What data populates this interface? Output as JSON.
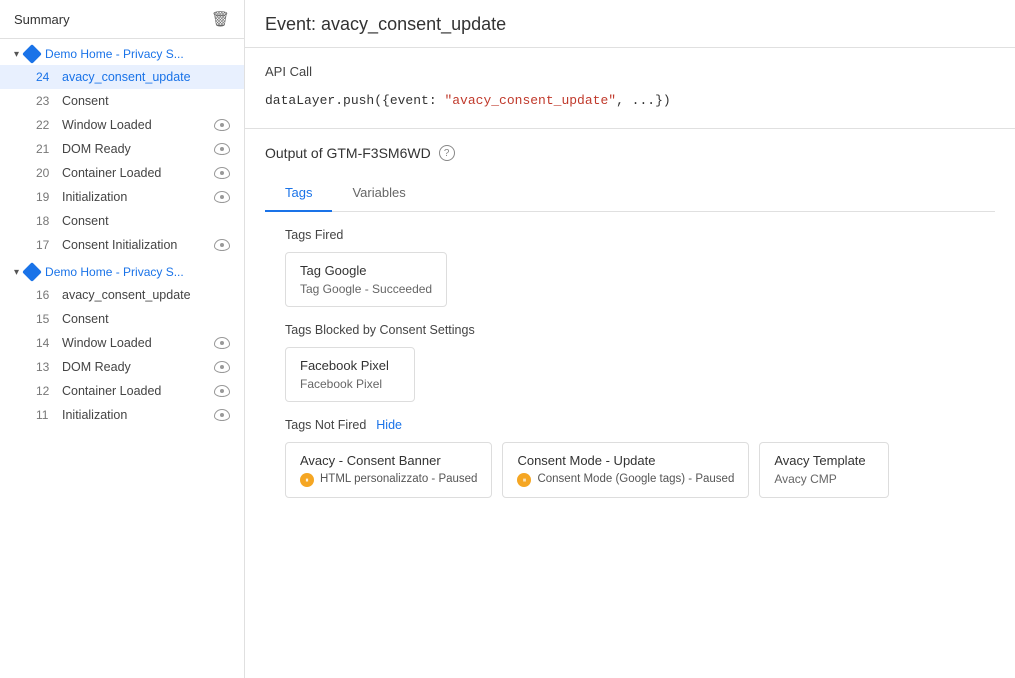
{
  "sidebar": {
    "header": {
      "title": "Summary",
      "trash_icon": "🗑"
    },
    "groups": [
      {
        "label": "Demo Home - Privacy S...",
        "id": "group1",
        "items": [
          {
            "num": "24",
            "label": "avacy_consent_update",
            "active": true,
            "has_eye": false
          },
          {
            "num": "23",
            "label": "Consent",
            "active": false,
            "has_eye": false
          },
          {
            "num": "22",
            "label": "Window Loaded",
            "active": false,
            "has_eye": true
          },
          {
            "num": "21",
            "label": "DOM Ready",
            "active": false,
            "has_eye": true
          },
          {
            "num": "20",
            "label": "Container Loaded",
            "active": false,
            "has_eye": true
          },
          {
            "num": "19",
            "label": "Initialization",
            "active": false,
            "has_eye": true
          },
          {
            "num": "18",
            "label": "Consent",
            "active": false,
            "has_eye": false
          },
          {
            "num": "17",
            "label": "Consent Initialization",
            "active": false,
            "has_eye": true
          }
        ]
      },
      {
        "label": "Demo Home - Privacy S...",
        "id": "group2",
        "items": [
          {
            "num": "16",
            "label": "avacy_consent_update",
            "active": false,
            "has_eye": false
          },
          {
            "num": "15",
            "label": "Consent",
            "active": false,
            "has_eye": false
          },
          {
            "num": "14",
            "label": "Window Loaded",
            "active": false,
            "has_eye": true
          },
          {
            "num": "13",
            "label": "DOM Ready",
            "active": false,
            "has_eye": true
          },
          {
            "num": "12",
            "label": "Container Loaded",
            "active": false,
            "has_eye": true
          },
          {
            "num": "11",
            "label": "Initialization",
            "active": false,
            "has_eye": true
          }
        ]
      }
    ]
  },
  "main": {
    "event_title": "Event: avacy_consent_update",
    "api_call_title": "API Call",
    "code_prefix": "dataLayer.push({event: ",
    "code_value": "\"avacy_consent_update\"",
    "code_suffix": ", ...})",
    "output_title": "Output of GTM-F3SM6WD",
    "tabs": [
      {
        "label": "Tags",
        "active": true
      },
      {
        "label": "Variables",
        "active": false
      }
    ],
    "tags_fired_title": "Tags Fired",
    "tags_fired": [
      {
        "title": "Tag Google",
        "subtitle": "Tag Google - Succeeded"
      }
    ],
    "tags_blocked_title": "Tags Blocked by Consent Settings",
    "tags_blocked": [
      {
        "title": "Facebook Pixel",
        "subtitle": "Facebook Pixel"
      }
    ],
    "tags_not_fired_title": "Tags Not Fired",
    "hide_label": "Hide",
    "tags_not_fired": [
      {
        "title": "Avacy - Consent Banner",
        "subtitle": "HTML personalizzato - Paused",
        "paused": true
      },
      {
        "title": "Consent Mode - Update",
        "subtitle": "Consent Mode (Google tags) - Paused",
        "paused": true
      },
      {
        "title": "Avacy Template",
        "subtitle": "Avacy CMP",
        "paused": false
      }
    ]
  }
}
